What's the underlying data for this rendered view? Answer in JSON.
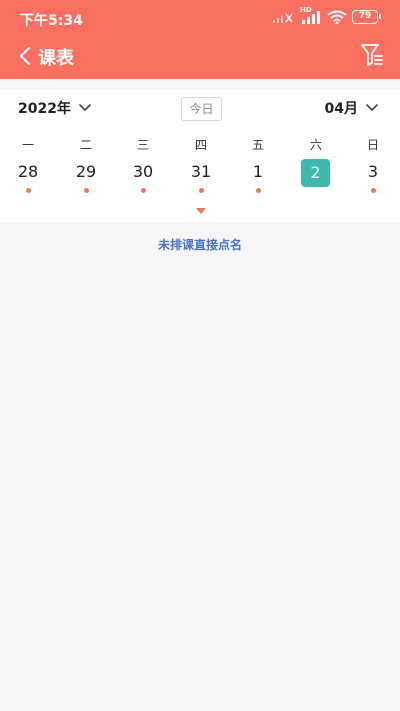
{
  "status_bar": {
    "time": "下午5:34",
    "battery": "79",
    "network_label": "HD"
  },
  "nav": {
    "title": "课表"
  },
  "calendar": {
    "year": "2022年",
    "month": "04月",
    "today_label": "今日",
    "weekdays": [
      "一",
      "二",
      "三",
      "四",
      "五",
      "六",
      "日"
    ],
    "days": [
      {
        "label": "28",
        "has_dot": true,
        "selected": false
      },
      {
        "label": "29",
        "has_dot": true,
        "selected": false
      },
      {
        "label": "30",
        "has_dot": true,
        "selected": false
      },
      {
        "label": "31",
        "has_dot": true,
        "selected": false
      },
      {
        "label": "1",
        "has_dot": true,
        "selected": false
      },
      {
        "label": "2",
        "has_dot": false,
        "selected": true
      },
      {
        "label": "3",
        "has_dot": true,
        "selected": false
      }
    ]
  },
  "actions": {
    "direct_roll_call": "未排课直接点名"
  },
  "colors": {
    "header": "#fb6f60",
    "selected_day": "#3db8ac",
    "dot": "#e9775f",
    "link": "#4b73c8"
  }
}
